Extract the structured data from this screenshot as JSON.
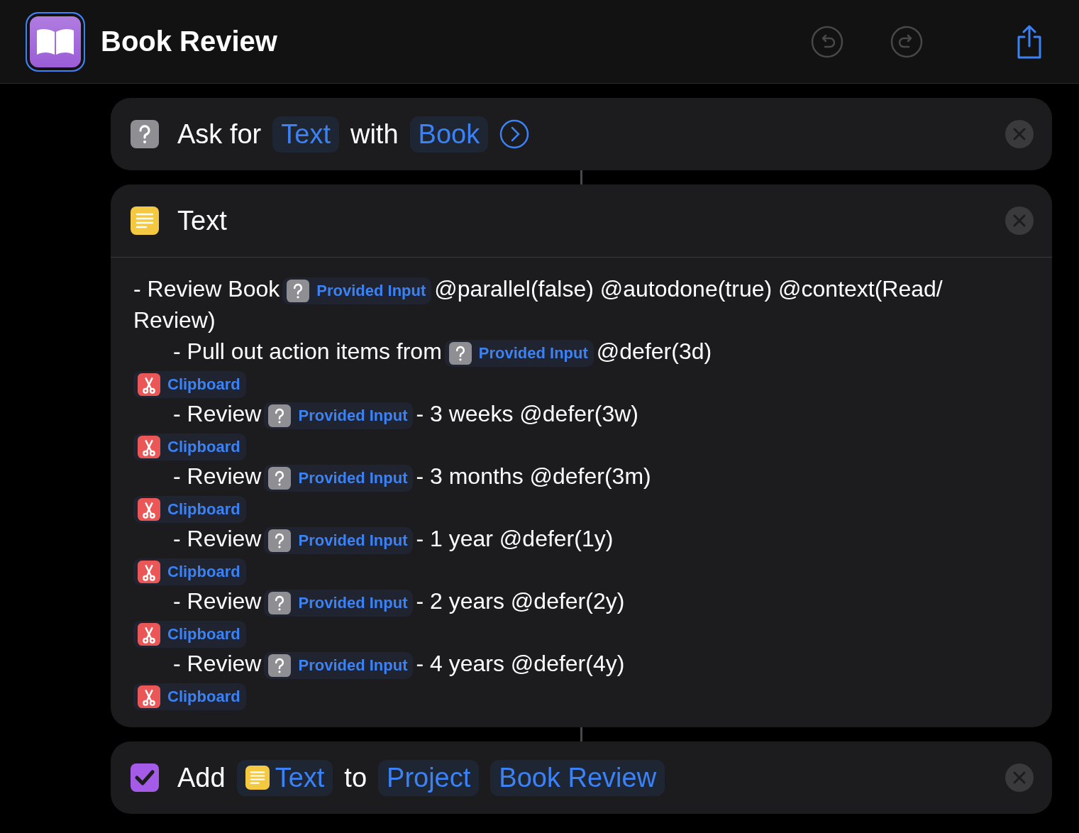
{
  "header": {
    "title": "Book Review"
  },
  "actions": [
    {
      "kind": "ask",
      "parts": [
        {
          "kind": "text",
          "text": "Ask for"
        },
        {
          "kind": "token",
          "text": "Text"
        },
        {
          "kind": "text",
          "text": "with"
        },
        {
          "kind": "token",
          "text": "Book"
        },
        {
          "kind": "chevron"
        }
      ]
    },
    {
      "kind": "text-block",
      "parts": [
        {
          "kind": "text",
          "text": "Text"
        }
      ],
      "lines": [
        {
          "indented": false,
          "segments": [
            {
              "kind": "text",
              "text": "- Review Book"
            },
            {
              "kind": "input-token",
              "text": "Provided Input"
            },
            {
              "kind": "text",
              "text": "@parallel(false) @autodone(true) @context(Read/"
            }
          ]
        },
        {
          "indented": false,
          "segments": [
            {
              "kind": "text",
              "text": "Review)"
            }
          ]
        },
        {
          "indented": true,
          "segments": [
            {
              "kind": "text",
              "text": "- Pull out action items from"
            },
            {
              "kind": "input-token",
              "text": "Provided Input"
            },
            {
              "kind": "text",
              "text": "@defer(3d)"
            }
          ]
        },
        {
          "indented": false,
          "segments": [
            {
              "kind": "clipboard-token",
              "text": "Clipboard"
            }
          ]
        },
        {
          "indented": true,
          "segments": [
            {
              "kind": "text",
              "text": "- Review"
            },
            {
              "kind": "input-token",
              "text": "Provided Input"
            },
            {
              "kind": "text",
              "text": "- 3 weeks @defer(3w)"
            }
          ]
        },
        {
          "indented": false,
          "segments": [
            {
              "kind": "clipboard-token",
              "text": "Clipboard"
            }
          ]
        },
        {
          "indented": true,
          "segments": [
            {
              "kind": "text",
              "text": "- Review"
            },
            {
              "kind": "input-token",
              "text": "Provided Input"
            },
            {
              "kind": "text",
              "text": "- 3 months @defer(3m)"
            }
          ]
        },
        {
          "indented": false,
          "segments": [
            {
              "kind": "clipboard-token",
              "text": "Clipboard"
            }
          ]
        },
        {
          "indented": true,
          "segments": [
            {
              "kind": "text",
              "text": "- Review"
            },
            {
              "kind": "input-token",
              "text": "Provided Input"
            },
            {
              "kind": "text",
              "text": "- 1 year @defer(1y)"
            }
          ]
        },
        {
          "indented": false,
          "segments": [
            {
              "kind": "clipboard-token",
              "text": "Clipboard"
            }
          ]
        },
        {
          "indented": true,
          "segments": [
            {
              "kind": "text",
              "text": "- Review"
            },
            {
              "kind": "input-token",
              "text": "Provided Input"
            },
            {
              "kind": "text",
              "text": "- 2 years @defer(2y)"
            }
          ]
        },
        {
          "indented": false,
          "segments": [
            {
              "kind": "clipboard-token",
              "text": "Clipboard"
            }
          ]
        },
        {
          "indented": true,
          "segments": [
            {
              "kind": "text",
              "text": "- Review"
            },
            {
              "kind": "input-token",
              "text": "Provided Input"
            },
            {
              "kind": "text",
              "text": "- 4 years @defer(4y)"
            }
          ]
        },
        {
          "indented": false,
          "segments": [
            {
              "kind": "clipboard-token",
              "text": "Clipboard"
            }
          ]
        }
      ]
    },
    {
      "kind": "add",
      "parts": [
        {
          "kind": "text",
          "text": "Add"
        },
        {
          "kind": "text-token",
          "text": "Text"
        },
        {
          "kind": "text",
          "text": "to"
        },
        {
          "kind": "token",
          "text": "Project"
        },
        {
          "kind": "token",
          "text": "Book Review"
        }
      ]
    }
  ]
}
